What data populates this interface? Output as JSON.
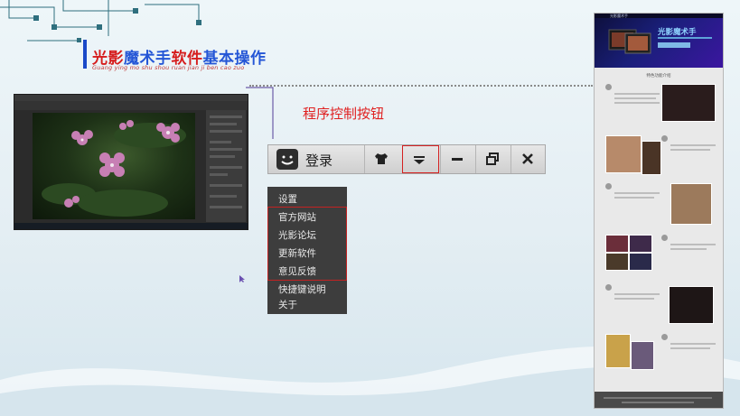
{
  "slide": {
    "title_part1": "光影",
    "title_part2": "魔术手",
    "title_part3": "软件",
    "title_part4": "基本操作",
    "subtitle": "Guang ying mo shu shou ruan jian ji ben cao zuo"
  },
  "callout": {
    "label": "程序控制按钮"
  },
  "control_bar": {
    "login_label": "登录",
    "buttons": [
      "skin-icon",
      "menu-dropdown-icon",
      "minimize-icon",
      "restore-icon",
      "close-icon"
    ]
  },
  "menu": {
    "items": [
      "设置",
      "官方网站",
      "光影论坛",
      "更新软件",
      "意见反馈",
      "快捷键说明",
      "关于"
    ],
    "highlighted": [
      "官方网站",
      "光影论坛",
      "更新软件",
      "意见反馈"
    ]
  },
  "web": {
    "banner_title": "光影魔术手",
    "logo": "光影魔术手",
    "heading": "特色功能介绍"
  },
  "colors": {
    "title_blue": "#2456d6",
    "title_red": "#d61e1e",
    "highlight_red": "#d42020"
  }
}
